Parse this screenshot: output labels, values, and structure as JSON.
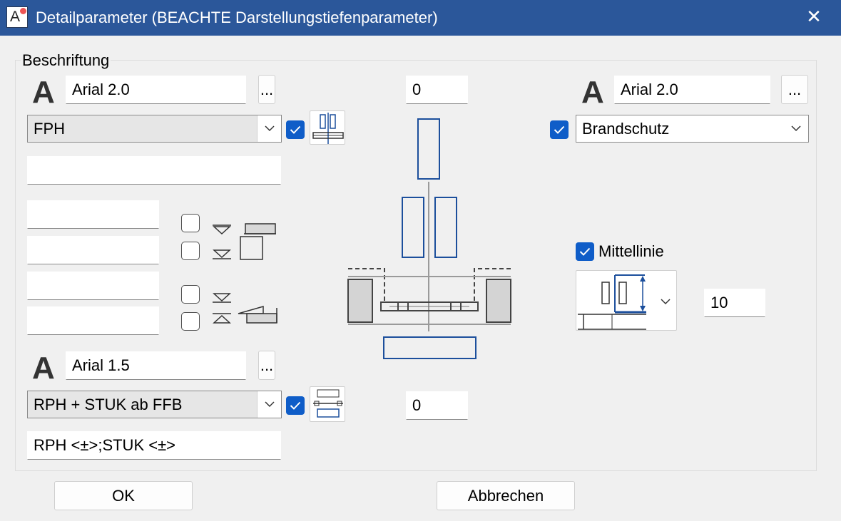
{
  "window": {
    "title": "Detailparameter (BEACHTE Darstellungstiefenparameter)",
    "close_label": "✕",
    "app_icon_letter": "A"
  },
  "group": {
    "label": "Beschriftung"
  },
  "left_top": {
    "font_glyph": "A",
    "font_value": "Arial 2.0",
    "dots_label": "...",
    "combo_value": "FPH",
    "checked": true,
    "text_field": ""
  },
  "left_small_fields": [
    "",
    "",
    "",
    ""
  ],
  "option_checkboxes": [
    false,
    false,
    false,
    false
  ],
  "left_bottom": {
    "font_glyph": "A",
    "font_value": "Arial 1.5",
    "dots_label": "...",
    "combo_value": "RPH + STUK ab FFB",
    "checked": true,
    "text_field": "RPH <±>;STUK <±>"
  },
  "center": {
    "top_value": "0",
    "bottom_value": "0"
  },
  "right": {
    "font_glyph": "A",
    "font_value": "Arial 2.0",
    "dots_label": "...",
    "combo_checked": true,
    "combo_value": "Brandschutz",
    "mittellinie_checked": true,
    "mittellinie_label": "Mittellinie",
    "distance_value": "10"
  },
  "footer": {
    "ok_label": "OK",
    "cancel_label": "Abbrechen"
  },
  "colors": {
    "titlebar": "#2b579a",
    "accent": "#0f5dc8",
    "drawing_blue": "#1c4f9c"
  }
}
